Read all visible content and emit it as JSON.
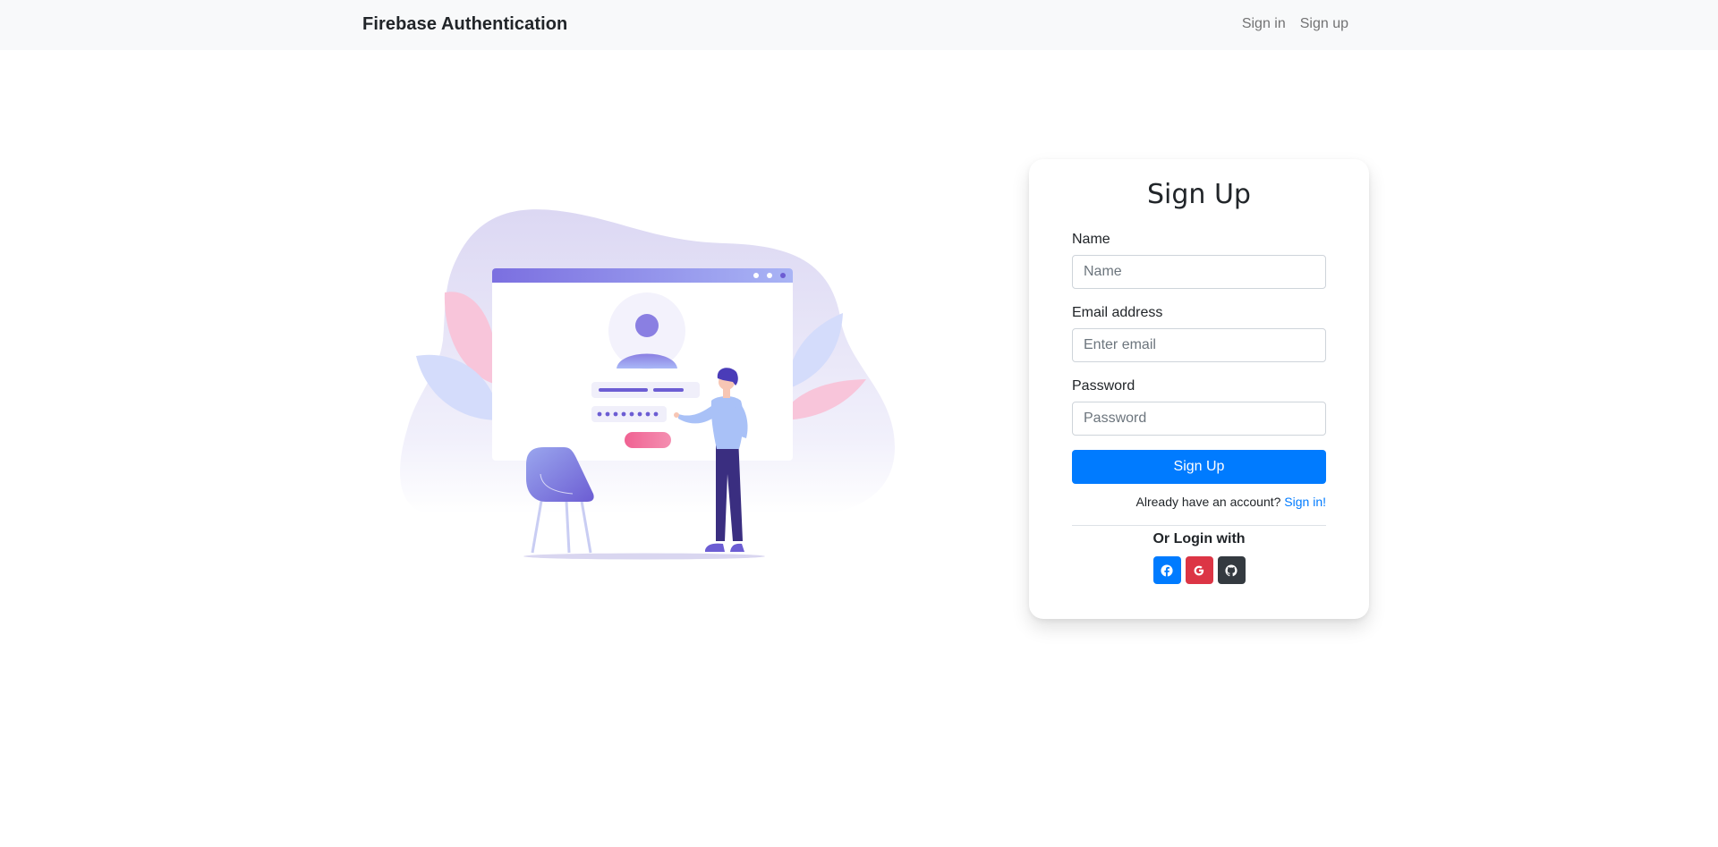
{
  "navbar": {
    "brand": "Firebase Authentication",
    "links": [
      {
        "label": "Sign in"
      },
      {
        "label": "Sign up"
      }
    ]
  },
  "form": {
    "title": "Sign Up",
    "fields": [
      {
        "label": "Name",
        "placeholder": "Name",
        "value": ""
      },
      {
        "label": "Email address",
        "placeholder": "Enter email",
        "value": ""
      },
      {
        "label": "Password",
        "placeholder": "Password",
        "value": ""
      }
    ],
    "submit_label": "Sign Up",
    "signin_prompt": "Already have an account?",
    "signin_link": "Sign in!",
    "or_login_label": "Or Login with",
    "social": [
      {
        "icon": "facebook-icon",
        "color": "#007bff"
      },
      {
        "icon": "google-icon",
        "color": "#dc3545"
      },
      {
        "icon": "github-icon",
        "color": "#343a40"
      }
    ]
  },
  "colors": {
    "primary": "#007bff",
    "danger": "#dc3545",
    "dark": "#343a40",
    "illustration_purple": "#6c5dd3",
    "illustration_pink": "#f06292"
  }
}
